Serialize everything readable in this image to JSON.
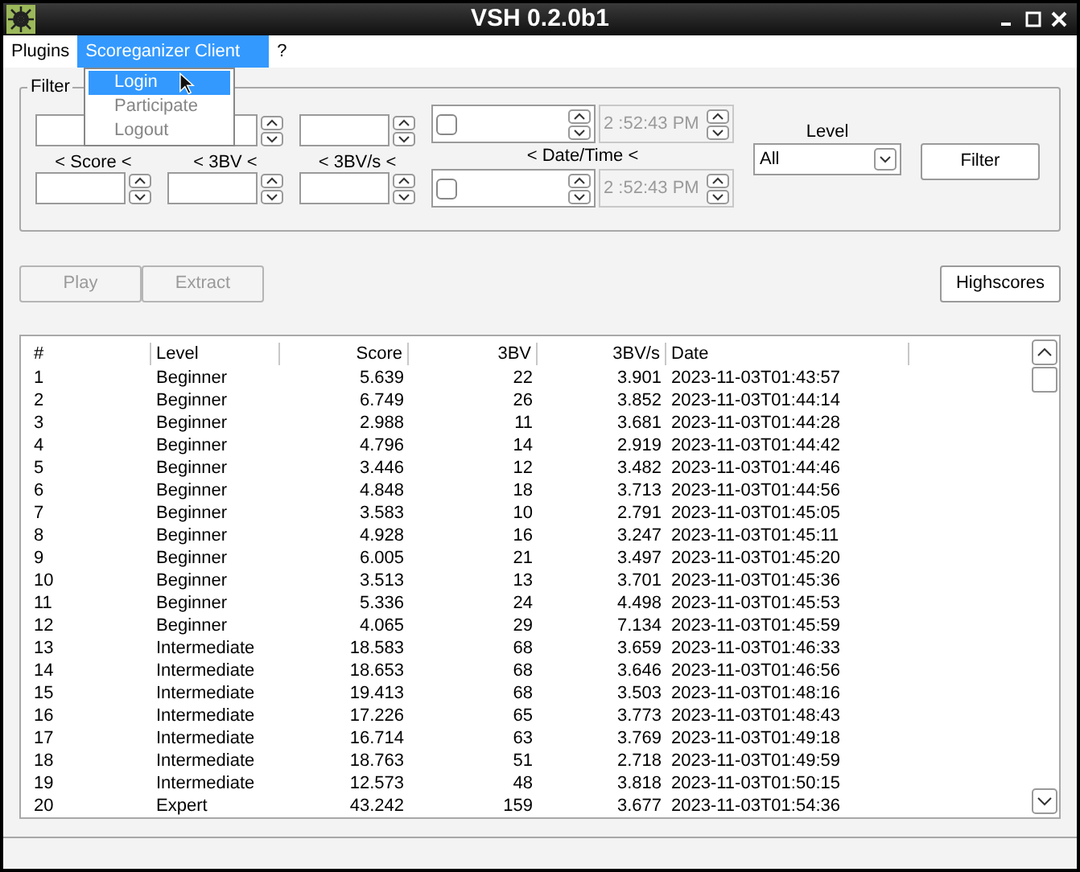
{
  "window": {
    "title": "VSH 0.2.0b1"
  },
  "menubar": [
    {
      "label": "Plugins",
      "selected": false
    },
    {
      "label": "Scoreganizer Client",
      "selected": true
    },
    {
      "label": "?",
      "selected": false
    }
  ],
  "dropdown": [
    {
      "label": "Login",
      "selected": true,
      "disabled": false
    },
    {
      "label": "Participate",
      "selected": false,
      "disabled": true
    },
    {
      "label": "Logout",
      "selected": false,
      "disabled": true
    }
  ],
  "filter": {
    "title": "Filter",
    "ranges": [
      {
        "label": "< Score <"
      },
      {
        "label": "< 3BV <"
      },
      {
        "label": "< 3BV/s <"
      }
    ],
    "date_label": "< Date/Time <",
    "dates": [
      {
        "checked": false,
        "time": "2 :52:43 PM",
        "disabled": true
      },
      {
        "checked": false,
        "time": "2 :52:43 PM",
        "disabled": true
      }
    ],
    "level_label": "Level",
    "level_value": "All",
    "button": "Filter"
  },
  "actions": [
    {
      "label": "Play",
      "disabled": true
    },
    {
      "label": "Extract",
      "disabled": true
    }
  ],
  "highscores_button": "Highscores",
  "table": {
    "columns": [
      "#",
      "Level",
      "Score",
      "3BV",
      "3BV/s",
      "Date"
    ],
    "rows": [
      [
        "1",
        "Beginner",
        "5.639",
        "22",
        "3.901",
        "2023-11-03T01:43:57"
      ],
      [
        "2",
        "Beginner",
        "6.749",
        "26",
        "3.852",
        "2023-11-03T01:44:14"
      ],
      [
        "3",
        "Beginner",
        "2.988",
        "11",
        "3.681",
        "2023-11-03T01:44:28"
      ],
      [
        "4",
        "Beginner",
        "4.796",
        "14",
        "2.919",
        "2023-11-03T01:44:42"
      ],
      [
        "5",
        "Beginner",
        "3.446",
        "12",
        "3.482",
        "2023-11-03T01:44:46"
      ],
      [
        "6",
        "Beginner",
        "4.848",
        "18",
        "3.713",
        "2023-11-03T01:44:56"
      ],
      [
        "7",
        "Beginner",
        "3.583",
        "10",
        "2.791",
        "2023-11-03T01:45:05"
      ],
      [
        "8",
        "Beginner",
        "4.928",
        "16",
        "3.247",
        "2023-11-03T01:45:11"
      ],
      [
        "9",
        "Beginner",
        "6.005",
        "21",
        "3.497",
        "2023-11-03T01:45:20"
      ],
      [
        "10",
        "Beginner",
        "3.513",
        "13",
        "3.701",
        "2023-11-03T01:45:36"
      ],
      [
        "11",
        "Beginner",
        "5.336",
        "24",
        "4.498",
        "2023-11-03T01:45:53"
      ],
      [
        "12",
        "Beginner",
        "4.065",
        "29",
        "7.134",
        "2023-11-03T01:45:59"
      ],
      [
        "13",
        "Intermediate",
        "18.583",
        "68",
        "3.659",
        "2023-11-03T01:46:33"
      ],
      [
        "14",
        "Intermediate",
        "18.653",
        "68",
        "3.646",
        "2023-11-03T01:46:56"
      ],
      [
        "15",
        "Intermediate",
        "19.413",
        "68",
        "3.503",
        "2023-11-03T01:48:16"
      ],
      [
        "16",
        "Intermediate",
        "17.226",
        "65",
        "3.773",
        "2023-11-03T01:48:43"
      ],
      [
        "17",
        "Intermediate",
        "16.714",
        "63",
        "3.769",
        "2023-11-03T01:49:18"
      ],
      [
        "18",
        "Intermediate",
        "18.763",
        "51",
        "2.718",
        "2023-11-03T01:49:59"
      ],
      [
        "19",
        "Intermediate",
        "12.573",
        "48",
        "3.818",
        "2023-11-03T01:50:15"
      ],
      [
        "20",
        "Expert",
        "43.242",
        "159",
        "3.677",
        "2023-11-03T01:54:36"
      ]
    ]
  }
}
